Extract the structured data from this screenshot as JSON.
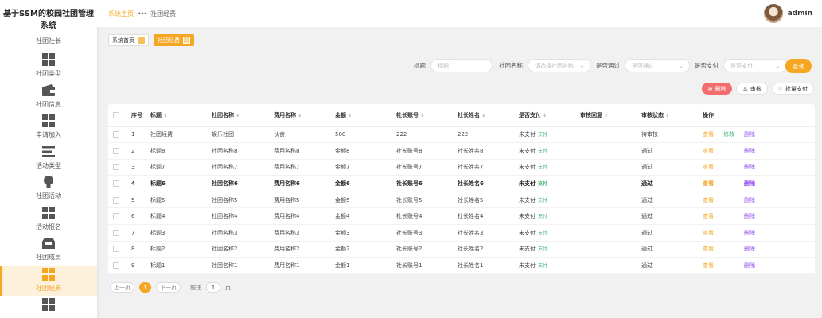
{
  "app": {
    "title": "基于SSM的校园社团管理系统"
  },
  "sidebar": {
    "items": [
      {
        "label": "社团社长",
        "icon": "group-icon"
      },
      {
        "label": "社团类型",
        "icon": "grid-icon"
      },
      {
        "label": "社团信息",
        "icon": "wallet-icon"
      },
      {
        "label": "申请加入",
        "icon": "grid-icon"
      },
      {
        "label": "活动类型",
        "icon": "list-icon"
      },
      {
        "label": "社团活动",
        "icon": "bulb-icon"
      },
      {
        "label": "活动报名",
        "icon": "grid-icon"
      },
      {
        "label": "社团成员",
        "icon": "inbox-icon"
      },
      {
        "label": "社团经费",
        "icon": "grid-icon"
      },
      {
        "label": "",
        "icon": "grid-icon"
      }
    ],
    "active_color": "#f5a623"
  },
  "breadcrumb": {
    "home": "系统主页",
    "sep": "•••",
    "current": "社团经费"
  },
  "user": {
    "name": "admin"
  },
  "tabs": [
    {
      "label": "系统首页"
    },
    {
      "label": "社团经费"
    }
  ],
  "search": {
    "title_label": "标题",
    "title_placeholder": "标题",
    "club_label": "社团名称",
    "club_placeholder": "请选择社团名称",
    "approve_label": "是否通过",
    "approve_placeholder": "是否通过",
    "paid_label": "是否支付",
    "paid_placeholder": "是否支付",
    "search_button": "查询"
  },
  "actions": {
    "delete": "删除",
    "review": "审核",
    "batch_pay": "批量支付"
  },
  "table": {
    "headers": [
      "序号",
      "标题",
      "社团名称",
      "费用名称",
      "金额",
      "社长账号",
      "社长姓名",
      "是否支付",
      "审核回复",
      "审核状态",
      "操作"
    ],
    "rows": [
      {
        "no": "1",
        "title": "社团经费",
        "club": "娱乐社团",
        "fee": "伙食",
        "amount": "500",
        "account": "222",
        "name": "222",
        "paid": "未支付",
        "pay": "支付",
        "reply": "",
        "status": "待审核",
        "view": "查看",
        "edit": "修改",
        "del": "删除"
      },
      {
        "no": "2",
        "title": "标题8",
        "club": "社团名称8",
        "fee": "费用名称8",
        "amount": "金额8",
        "account": "社长账号8",
        "name": "社长姓名8",
        "paid": "未支付",
        "pay": "支付",
        "reply": "",
        "status": "通过",
        "view": "查看",
        "edit": "",
        "del": "删除"
      },
      {
        "no": "3",
        "title": "标题7",
        "club": "社团名称7",
        "fee": "费用名称7",
        "amount": "金额7",
        "account": "社长账号7",
        "name": "社长姓名7",
        "paid": "未支付",
        "pay": "支付",
        "reply": "",
        "status": "通过",
        "view": "查看",
        "edit": "",
        "del": "删除"
      },
      {
        "no": "4",
        "title": "标题6",
        "club": "社团名称6",
        "fee": "费用名称6",
        "amount": "金额6",
        "account": "社长账号6",
        "name": "社长姓名6",
        "paid": "未支付",
        "pay": "支付",
        "reply": "",
        "status": "通过",
        "view": "查看",
        "edit": "",
        "del": "删除"
      },
      {
        "no": "5",
        "title": "标题5",
        "club": "社团名称5",
        "fee": "费用名称5",
        "amount": "金额5",
        "account": "社长账号5",
        "name": "社长姓名5",
        "paid": "未支付",
        "pay": "支付",
        "reply": "",
        "status": "通过",
        "view": "查看",
        "edit": "",
        "del": "删除"
      },
      {
        "no": "6",
        "title": "标题4",
        "club": "社团名称4",
        "fee": "费用名称4",
        "amount": "金额4",
        "account": "社长账号4",
        "name": "社长姓名4",
        "paid": "未支付",
        "pay": "支付",
        "reply": "",
        "status": "通过",
        "view": "查看",
        "edit": "",
        "del": "删除"
      },
      {
        "no": "7",
        "title": "标题3",
        "club": "社团名称3",
        "fee": "费用名称3",
        "amount": "金额3",
        "account": "社长账号3",
        "name": "社长姓名3",
        "paid": "未支付",
        "pay": "支付",
        "reply": "",
        "status": "通过",
        "view": "查看",
        "edit": "",
        "del": "删除"
      },
      {
        "no": "8",
        "title": "标题2",
        "club": "社团名称2",
        "fee": "费用名称2",
        "amount": "金额2",
        "account": "社长账号2",
        "name": "社长姓名2",
        "paid": "未支付",
        "pay": "支付",
        "reply": "",
        "status": "通过",
        "view": "查看",
        "edit": "",
        "del": "删除"
      },
      {
        "no": "9",
        "title": "标题1",
        "club": "社团名称1",
        "fee": "费用名称1",
        "amount": "金额1",
        "account": "社长账号1",
        "name": "社长姓名1",
        "paid": "未支付",
        "pay": "支付",
        "reply": "",
        "status": "通过",
        "view": "查看",
        "edit": "",
        "del": "删除"
      }
    ]
  },
  "pager": {
    "prev": "上一页",
    "current": "1",
    "next": "下一页",
    "goto": "前往",
    "goto_value": "1",
    "page_unit": "页"
  }
}
